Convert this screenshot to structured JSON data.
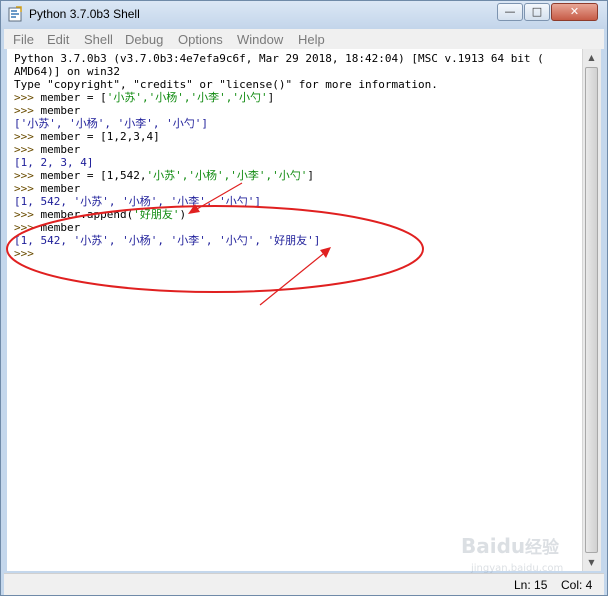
{
  "window": {
    "title": "Python 3.7.0b3 Shell",
    "controls": {
      "minimize": "—",
      "maximize": "□",
      "close": "✕"
    }
  },
  "menu": [
    "File",
    "Edit",
    "Shell",
    "Debug",
    "Options",
    "Window",
    "Help"
  ],
  "shell_lines": [
    {
      "kind": "out",
      "parts": [
        {
          "t": "Python 3.7.0b3 (v3.7.0b3:4e7efa9c6f, Mar 29 2018, 18:42:04) [MSC v.1913 64 bit (",
          "c": "text"
        }
      ]
    },
    {
      "kind": "out",
      "parts": [
        {
          "t": "AMD64)] on win32",
          "c": "text"
        }
      ]
    },
    {
      "kind": "out",
      "parts": [
        {
          "t": "Type \"copyright\", \"credits\" or \"license()\" for more information.",
          "c": "text"
        }
      ]
    },
    {
      "kind": "in",
      "parts": [
        {
          "t": ">>> ",
          "c": "prompt"
        },
        {
          "t": "member = [",
          "c": "text"
        },
        {
          "t": "'小苏','小杨','小李','小勺'",
          "c": "str"
        },
        {
          "t": "]",
          "c": "text"
        }
      ]
    },
    {
      "kind": "in",
      "parts": [
        {
          "t": ">>> ",
          "c": "prompt"
        },
        {
          "t": "member",
          "c": "text"
        }
      ]
    },
    {
      "kind": "out",
      "parts": [
        {
          "t": "['小苏', '小杨', '小李', '小勺']",
          "c": "out"
        }
      ]
    },
    {
      "kind": "in",
      "parts": [
        {
          "t": ">>> ",
          "c": "prompt"
        },
        {
          "t": "member = [1,2,3,4]",
          "c": "text"
        }
      ]
    },
    {
      "kind": "in",
      "parts": [
        {
          "t": ">>> ",
          "c": "prompt"
        },
        {
          "t": "member",
          "c": "text"
        }
      ]
    },
    {
      "kind": "out",
      "parts": [
        {
          "t": "[1, 2, 3, 4]",
          "c": "out"
        }
      ]
    },
    {
      "kind": "in",
      "parts": [
        {
          "t": ">>> ",
          "c": "prompt"
        },
        {
          "t": "member = [1,542,",
          "c": "text"
        },
        {
          "t": "'小苏','小杨','小李','小勺'",
          "c": "str"
        },
        {
          "t": "]",
          "c": "text"
        }
      ]
    },
    {
      "kind": "in",
      "parts": [
        {
          "t": ">>> ",
          "c": "prompt"
        },
        {
          "t": "member",
          "c": "text"
        }
      ]
    },
    {
      "kind": "out",
      "parts": [
        {
          "t": "[1, 542, '小苏', '小杨', '小李', '小勺']",
          "c": "out"
        }
      ]
    },
    {
      "kind": "in",
      "parts": [
        {
          "t": ">>> ",
          "c": "prompt"
        },
        {
          "t": "member.append(",
          "c": "text"
        },
        {
          "t": "'好朋友'",
          "c": "str"
        },
        {
          "t": ")",
          "c": "text"
        }
      ]
    },
    {
      "kind": "in",
      "parts": [
        {
          "t": ">>> ",
          "c": "prompt"
        },
        {
          "t": "member",
          "c": "text"
        }
      ]
    },
    {
      "kind": "out",
      "parts": [
        {
          "t": "[1, 542, '小苏', '小杨', '小李', '小勺', '好朋友']",
          "c": "out"
        }
      ]
    },
    {
      "kind": "in",
      "parts": [
        {
          "t": ">>> ",
          "c": "prompt"
        }
      ]
    }
  ],
  "status": {
    "line": "Ln: 15",
    "column": "Col: 4"
  },
  "watermark": {
    "brand": "Baidu",
    "text": "经验",
    "url": "jingyan.baidu.com"
  },
  "colors": {
    "prompt": "#6a4c00",
    "string": "#0f8a0f",
    "output": "#1d1d99",
    "annotation": "#e02020"
  }
}
